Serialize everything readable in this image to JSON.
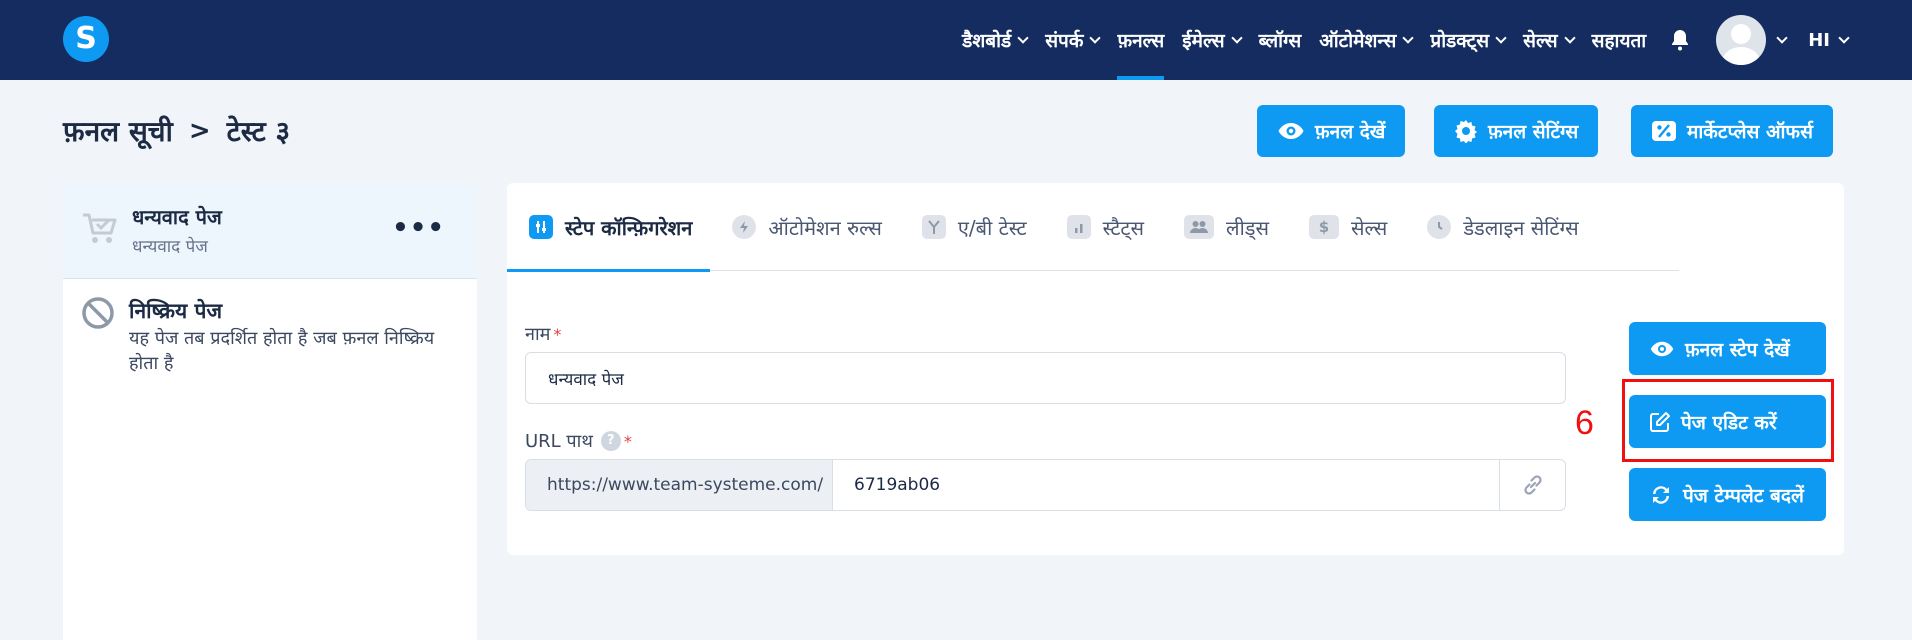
{
  "app": {
    "logo_letter": "S"
  },
  "nav": {
    "items": [
      {
        "label": "डैशबोर्ड",
        "dropdown": true,
        "active": false
      },
      {
        "label": "संपर्क",
        "dropdown": true,
        "active": false
      },
      {
        "label": "फ़नल्स",
        "dropdown": false,
        "active": true
      },
      {
        "label": "ईमेल्स",
        "dropdown": true,
        "active": false
      },
      {
        "label": "ब्लॉग्स",
        "dropdown": false,
        "active": false
      },
      {
        "label": "ऑटोमेशन्स",
        "dropdown": true,
        "active": false
      },
      {
        "label": "प्रोडक्ट्स",
        "dropdown": true,
        "active": false
      },
      {
        "label": "सेल्स",
        "dropdown": true,
        "active": false
      },
      {
        "label": "सहायता",
        "dropdown": false,
        "active": false
      }
    ],
    "language": "HI"
  },
  "breadcrumb": {
    "root": "फ़नल सूची",
    "separator": ">",
    "current": "टेस्ट ३"
  },
  "header_buttons": {
    "view_funnel": "फ़नल देखें",
    "funnel_settings": "फ़नल सेटिंग्स",
    "marketplace_offers": "मार्केटप्लेस ऑफर्स"
  },
  "steps": {
    "active": {
      "title": "धन्यवाद पेज",
      "subtitle": "धन्यवाद पेज"
    },
    "inactive": {
      "title": "निष्क्रिय पेज",
      "description": "यह पेज तब प्रदर्शित होता है जब फ़नल निष्क्रिय होता है"
    }
  },
  "tabs": [
    {
      "label": "स्टेप कॉन्फ़िगरेशन",
      "icon": "sliders-icon",
      "active": true
    },
    {
      "label": "ऑटोमेशन रुल्स",
      "icon": "bolt-icon",
      "active": false
    },
    {
      "label": "ए/बी टेस्ट",
      "icon": "split-icon",
      "active": false
    },
    {
      "label": "स्टैट्स",
      "icon": "bar-chart-icon",
      "active": false
    },
    {
      "label": "लीड्स",
      "icon": "users-icon",
      "active": false
    },
    {
      "label": "सेल्स",
      "icon": "dollar-icon",
      "active": false
    },
    {
      "label": "डेडलाइन सेटिंग्स",
      "icon": "clock-icon",
      "active": false
    }
  ],
  "form": {
    "name_label": "नाम",
    "name_value": "धन्यवाद पेज",
    "url_label": "URL पाथ",
    "url_help": "?",
    "url_prefix": "https://www.team-systeme.com/",
    "url_value": "6719ab06",
    "required_mark": "*"
  },
  "side_buttons": {
    "view_step": "फ़नल स्टेप देखें",
    "edit_page": "पेज एडिट करें",
    "change_template": "पेज टेम्पलेट बदलें"
  },
  "annotation": {
    "step_number": "6",
    "highlight_color": "#ee1111"
  },
  "colors": {
    "nav_bg": "#142c5f",
    "accent": "#0e9af2",
    "page_bg": "#f1f4f8"
  }
}
